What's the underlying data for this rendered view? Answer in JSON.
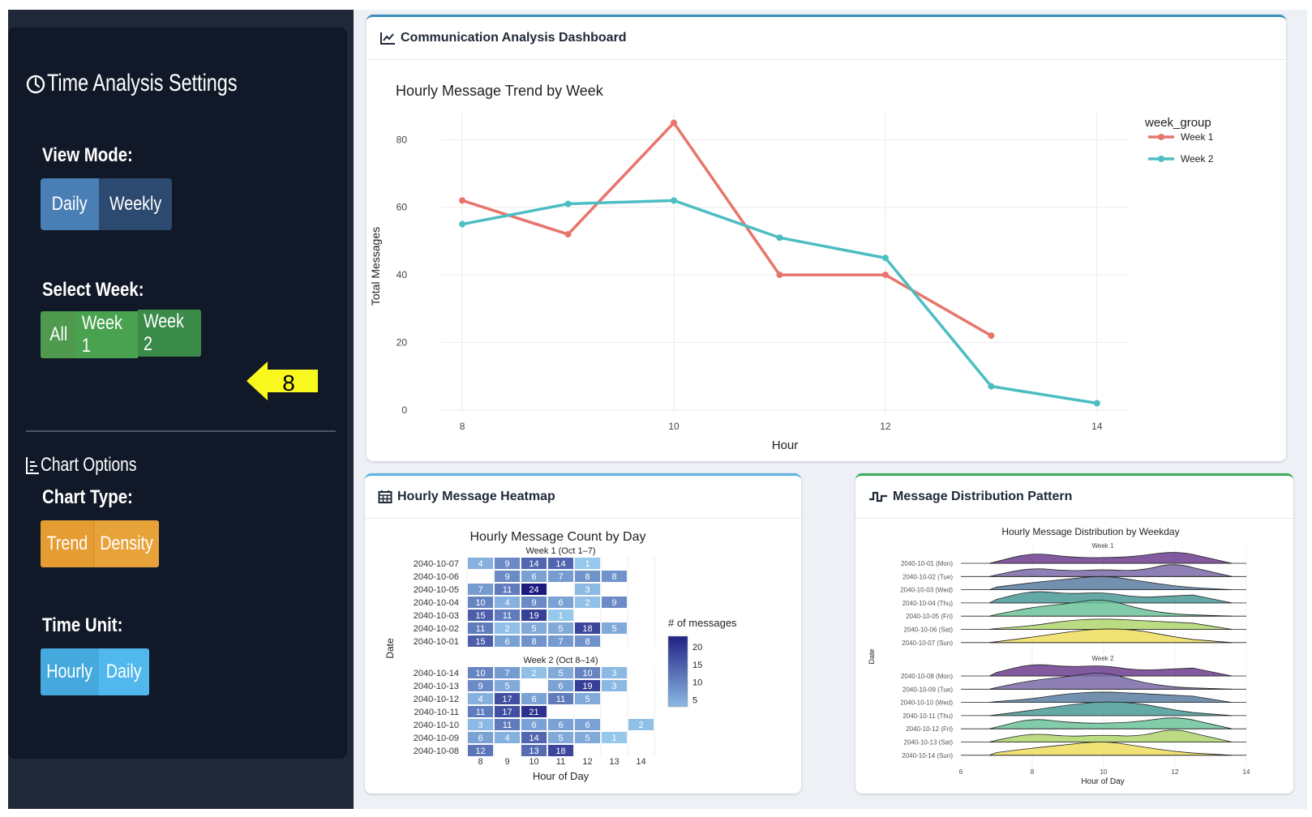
{
  "sidebar": {
    "title": "Time Analysis Settings",
    "view_mode": {
      "label": "View Mode:",
      "options": [
        "Daily",
        "Weekly"
      ],
      "selected": "Daily"
    },
    "select_week": {
      "label": "Select Week:",
      "options": [
        "All",
        "Week 1",
        "Week 2"
      ],
      "selected": "Week 2"
    },
    "annotation": {
      "number": "8"
    },
    "chart_options_title": "Chart Options",
    "chart_type": {
      "label": "Chart Type:",
      "options": [
        "Trend",
        "Density"
      ]
    },
    "time_unit": {
      "label": "Time Unit:",
      "options": [
        "Hourly",
        "Daily"
      ]
    }
  },
  "colors": {
    "sidebar_bg": "#111827",
    "view_btn": "#4a7fb5",
    "week_btn": "#3a8a4a",
    "chart_btn": "#e59d33",
    "time_btn": "#45a9dd",
    "week1": "#e8756b",
    "week2": "#4cbdc3"
  },
  "cards": {
    "trend": {
      "title": "Communication Analysis Dashboard",
      "icon": "line-chart-icon"
    },
    "heatmap": {
      "title": "Hourly Message Heatmap",
      "icon": "calendar-icon"
    },
    "distribution": {
      "title": "Message Distribution Pattern",
      "icon": "wave-icon"
    }
  },
  "chart_data": [
    {
      "type": "line",
      "title": "Hourly Message Trend by Week",
      "xlabel": "Hour",
      "ylabel": "Total Messages",
      "xticks": [
        8,
        10,
        12,
        14
      ],
      "yticks": [
        0,
        20,
        40,
        60,
        80
      ],
      "xlim": [
        7.8,
        14.3
      ],
      "ylim": [
        -1,
        88
      ],
      "legend_title": "week_group",
      "legend_position": "top-right",
      "grid": true,
      "series": [
        {
          "name": "Week 1",
          "x": [
            8,
            9,
            10,
            11,
            12,
            13
          ],
          "y": [
            62,
            52,
            85,
            40,
            40,
            22
          ]
        },
        {
          "name": "Week 2",
          "x": [
            8,
            9,
            10,
            11,
            12,
            13,
            14
          ],
          "y": [
            55,
            61,
            62,
            51,
            45,
            7,
            2
          ]
        }
      ]
    },
    {
      "type": "heatmap",
      "title": "Hourly Message Count by Day",
      "xlabel": "Hour of Day",
      "ylabel": "Date",
      "x": [
        8,
        9,
        10,
        11,
        12,
        13,
        14
      ],
      "legend_title": "# of messages",
      "legend_ticks": [
        5,
        10,
        15,
        20
      ],
      "panels": [
        {
          "name": "Week 1 (Oct 1–7)",
          "rows": [
            {
              "date": "2040-10-07",
              "cells": [
                [
                  8,
                  4
                ],
                [
                  9,
                  9
                ],
                [
                  10,
                  14
                ],
                [
                  11,
                  14
                ],
                [
                  12,
                  1
                ]
              ]
            },
            {
              "date": "2040-10-06",
              "cells": [
                [
                  9,
                  9
                ],
                [
                  10,
                  6
                ],
                [
                  11,
                  7
                ],
                [
                  12,
                  8
                ],
                [
                  13,
                  8
                ]
              ]
            },
            {
              "date": "2040-10-05",
              "cells": [
                [
                  8,
                  7
                ],
                [
                  9,
                  11
                ],
                [
                  10,
                  24
                ],
                [
                  12,
                  3
                ]
              ]
            },
            {
              "date": "2040-10-04",
              "cells": [
                [
                  8,
                  10
                ],
                [
                  9,
                  4
                ],
                [
                  10,
                  9
                ],
                [
                  11,
                  6
                ],
                [
                  12,
                  2
                ],
                [
                  13,
                  9
                ]
              ]
            },
            {
              "date": "2040-10-03",
              "cells": [
                [
                  8,
                  15
                ],
                [
                  9,
                  11
                ],
                [
                  10,
                  19
                ],
                [
                  11,
                  1
                ]
              ]
            },
            {
              "date": "2040-10-02",
              "cells": [
                [
                  8,
                  11
                ],
                [
                  9,
                  2
                ],
                [
                  10,
                  5
                ],
                [
                  11,
                  5
                ],
                [
                  12,
                  18
                ],
                [
                  13,
                  5
                ]
              ]
            },
            {
              "date": "2040-10-01",
              "cells": [
                [
                  8,
                  15
                ],
                [
                  9,
                  6
                ],
                [
                  10,
                  8
                ],
                [
                  11,
                  7
                ],
                [
                  12,
                  8
                ]
              ]
            }
          ]
        },
        {
          "name": "Week 2 (Oct 8–14)",
          "rows": [
            {
              "date": "2040-10-14",
              "cells": [
                [
                  8,
                  10
                ],
                [
                  9,
                  7
                ],
                [
                  10,
                  2
                ],
                [
                  11,
                  5
                ],
                [
                  12,
                  10
                ],
                [
                  13,
                  3
                ]
              ]
            },
            {
              "date": "2040-10-13",
              "cells": [
                [
                  8,
                  9
                ],
                [
                  9,
                  5
                ],
                [
                  11,
                  6
                ],
                [
                  12,
                  19
                ],
                [
                  13,
                  3
                ]
              ]
            },
            {
              "date": "2040-10-12",
              "cells": [
                [
                  8,
                  4
                ],
                [
                  9,
                  17
                ],
                [
                  10,
                  6
                ],
                [
                  11,
                  11
                ],
                [
                  12,
                  5
                ]
              ]
            },
            {
              "date": "2040-10-11",
              "cells": [
                [
                  8,
                  11
                ],
                [
                  9,
                  17
                ],
                [
                  10,
                  21
                ]
              ]
            },
            {
              "date": "2040-10-10",
              "cells": [
                [
                  8,
                  3
                ],
                [
                  9,
                  11
                ],
                [
                  10,
                  6
                ],
                [
                  11,
                  6
                ],
                [
                  12,
                  6
                ],
                [
                  14,
                  2
                ]
              ]
            },
            {
              "date": "2040-10-09",
              "cells": [
                [
                  8,
                  6
                ],
                [
                  9,
                  4
                ],
                [
                  10,
                  14
                ],
                [
                  11,
                  5
                ],
                [
                  12,
                  5
                ],
                [
                  13,
                  1
                ]
              ]
            },
            {
              "date": "2040-10-08",
              "cells": [
                [
                  8,
                  12
                ],
                [
                  10,
                  13
                ],
                [
                  11,
                  18
                ]
              ]
            }
          ]
        }
      ]
    },
    {
      "type": "area",
      "title": "Hourly Message Distribution by Weekday",
      "xlabel": "Hour of Day",
      "ylabel": "Date",
      "xticks": [
        6,
        8,
        10,
        12,
        14
      ],
      "panels": [
        {
          "name": "Week 1",
          "rows": [
            "2040-10-01 (Mon)",
            "2040-10-02 (Tue)",
            "2040-10-03 (Wed)",
            "2040-10-04 (Thu)",
            "2040-10-05 (Fri)",
            "2040-10-06 (Sat)",
            "2040-10-07 (Sun)"
          ]
        },
        {
          "name": "Week 2",
          "rows": [
            "2040-10-08 (Mon)",
            "2040-10-09 (Tue)",
            "2040-10-10 (Wed)",
            "2040-10-11 (Thu)",
            "2040-10-12 (Fri)",
            "2040-10-13 (Sat)",
            "2040-10-14 (Sun)"
          ]
        }
      ]
    }
  ]
}
